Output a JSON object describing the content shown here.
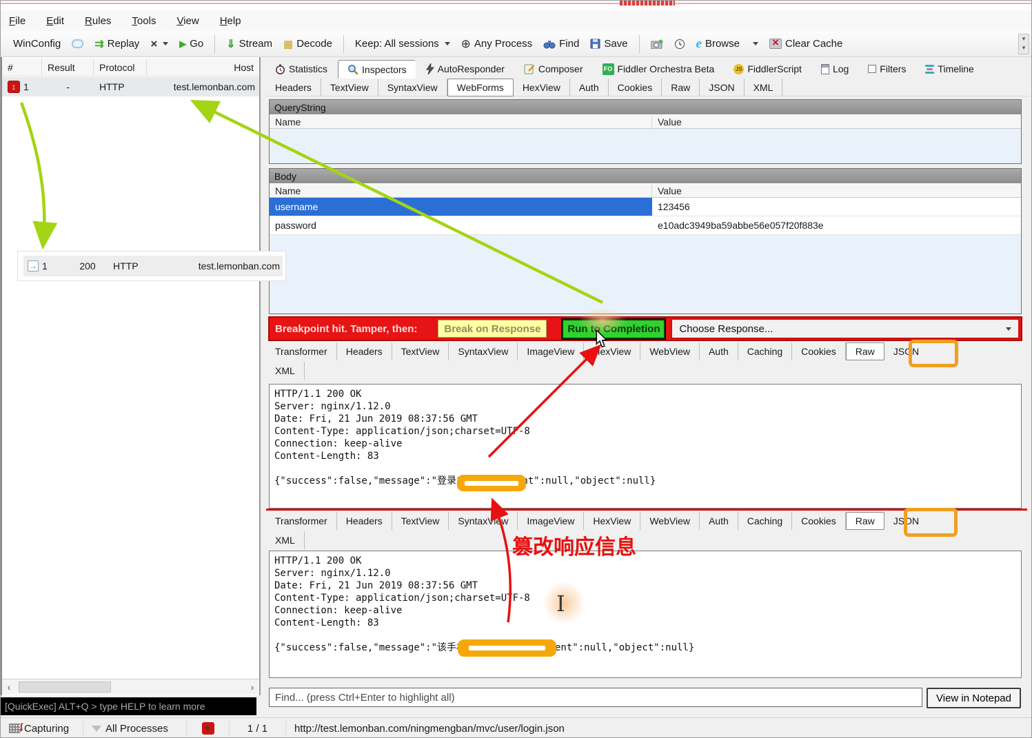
{
  "menu": {
    "items": [
      "File",
      "Edit",
      "Rules",
      "Tools",
      "View",
      "Help"
    ]
  },
  "toolbar": {
    "winconfig": "WinConfig",
    "replay": "Replay",
    "go": "Go",
    "stream": "Stream",
    "decode": "Decode",
    "keep": "Keep: All sessions",
    "any_process": "Any Process",
    "find": "Find",
    "save": "Save",
    "browse": "Browse",
    "clear_cache": "Clear Cache"
  },
  "session_list": {
    "columns": [
      "#",
      "Result",
      "Protocol",
      "Host"
    ],
    "row1": {
      "num": "1",
      "result": "-",
      "protocol": "HTTP",
      "host": "test.lemonban.com"
    },
    "row2": {
      "num": "1",
      "result": "200",
      "protocol": "HTTP",
      "host": "test.lemonban.com"
    }
  },
  "main_tabs": [
    "Statistics",
    "Inspectors",
    "AutoResponder",
    "Composer",
    "Fiddler Orchestra Beta",
    "FiddlerScript",
    "Log",
    "Filters",
    "Timeline"
  ],
  "request_tabs": [
    "Headers",
    "TextView",
    "SyntaxView",
    "WebForms",
    "HexView",
    "Auth",
    "Cookies",
    "Raw",
    "JSON",
    "XML"
  ],
  "request": {
    "querystring_title": "QueryString",
    "body_title": "Body",
    "col_name": "Name",
    "col_value": "Value",
    "body_rows": [
      {
        "name": "username",
        "value": "123456"
      },
      {
        "name": "password",
        "value": "e10adc3949ba59abbe56e057f20f883e"
      }
    ]
  },
  "breakpoint_bar": {
    "label": "Breakpoint hit. Tamper, then:",
    "break_button": "Break on Response",
    "run_button": "Run to Completion",
    "choose_dropdown": "Choose Response..."
  },
  "response_tabs": [
    "Transformer",
    "Headers",
    "TextView",
    "SyntaxView",
    "ImageView",
    "HexView",
    "WebView",
    "Auth",
    "Caching",
    "Cookies",
    "Raw",
    "JSON",
    "XML"
  ],
  "response_raw_original": "HTTP/1.1 200 OK\nServer: nginx/1.12.0\nDate: Fri, 21 Jun 2019 08:37:56 GMT\nContent-Type: application/json;charset=UTF-8\nConnection: keep-alive\nContent-Length: 83\n\n{\"success\":false,\"message\":\"登录成功\",\"content\":null,\"object\":null}",
  "response_raw_tampered": "HTTP/1.1 200 OK\nServer: nginx/1.12.0\nDate: Fri, 21 Jun 2019 08:37:56 GMT\nContent-Type: application/json;charset=UTF-8\nConnection: keep-alive\nContent-Length: 83\n\n{\"success\":false,\"message\":\"该手机号没有注册\",\"content\":null,\"object\":null}",
  "annotation": {
    "tamper_note": "篡改响应信息"
  },
  "find_bar": {
    "placeholder": "Find... (press Ctrl+Enter to highlight all)",
    "notepad_button": "View in Notepad"
  },
  "quickexec": {
    "text": "[QuickExec] ALT+Q > type HELP to learn more"
  },
  "status_bar": {
    "capturing": "Capturing",
    "processes": "All Processes",
    "count": "1 / 1",
    "url": "http://test.lemonban.com/ningmengban/mvc/user/login.json"
  },
  "colors": {
    "accent_red": "#e61414",
    "highlight_orange": "#f6a80a",
    "arrow_green": "#a4d414",
    "selection_blue": "#2b6fd6",
    "run_button_green": "#2ed32e",
    "break_button_yellow": "#ffffa3"
  }
}
